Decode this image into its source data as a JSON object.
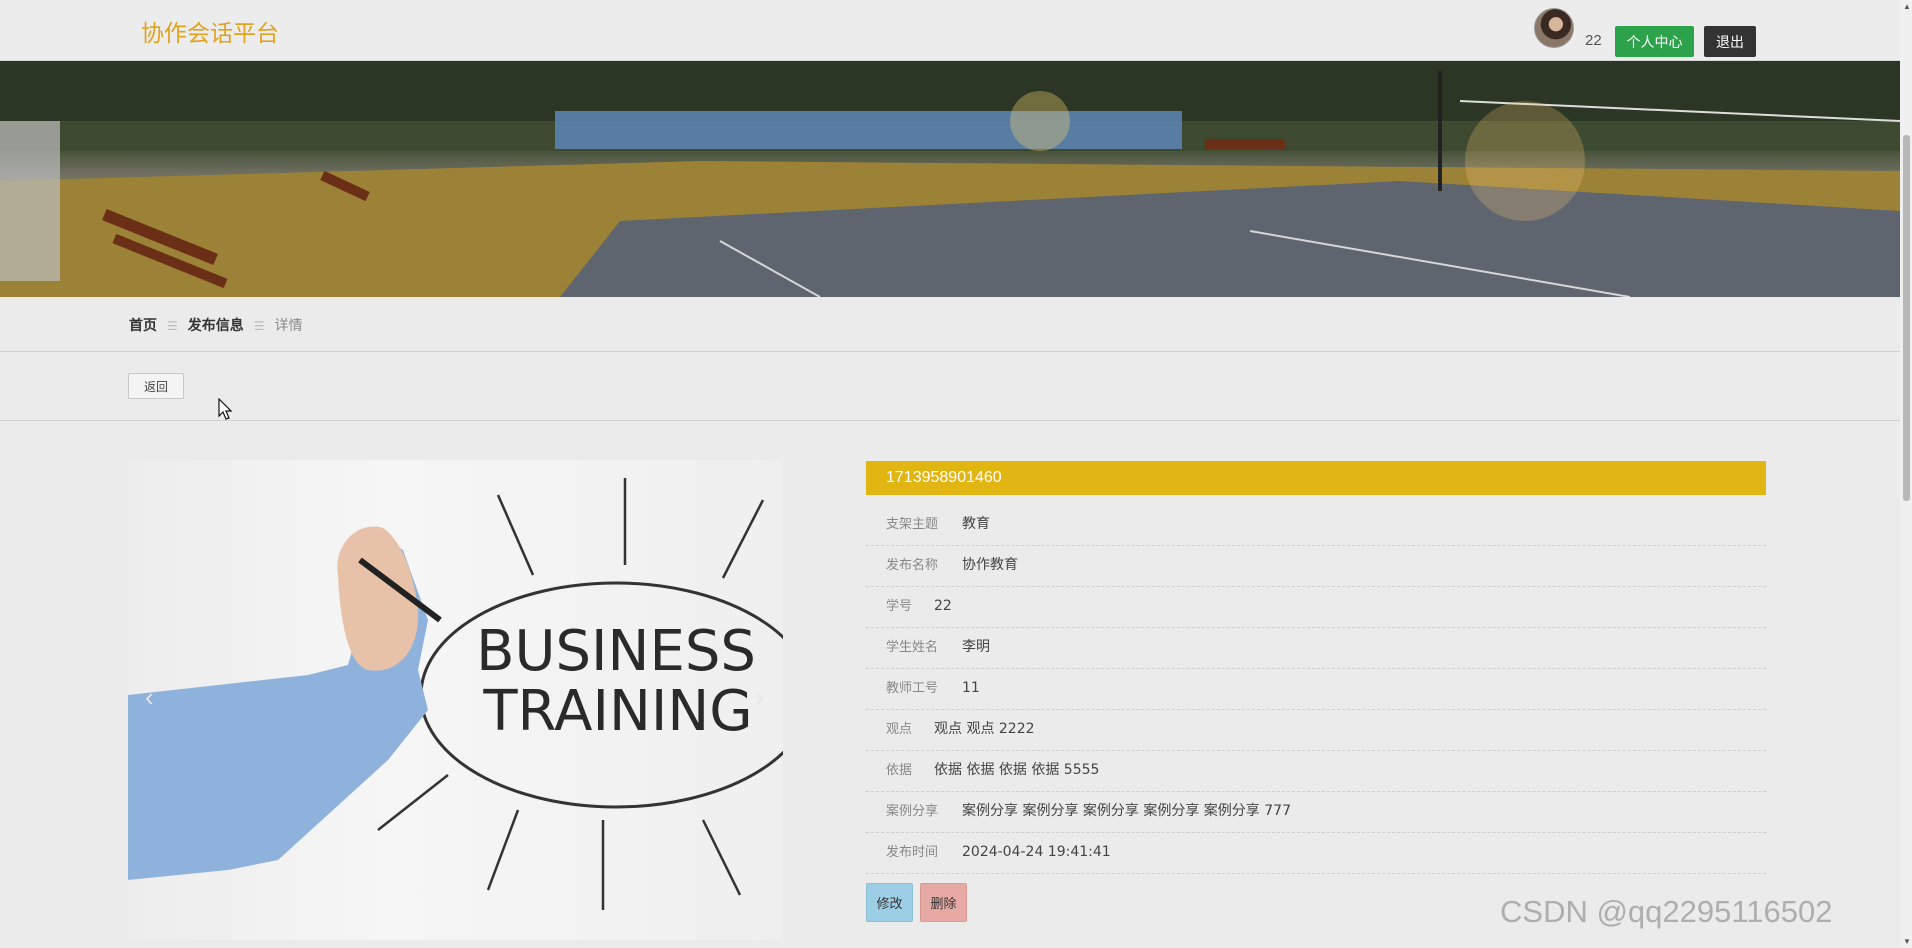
{
  "header": {
    "site_title": "协作会话平台",
    "user_id": "22",
    "personal_center_label": "个人中心",
    "logout_label": "退出"
  },
  "banner": {
    "slide_count": 3,
    "active_slide": 1
  },
  "breadcrumb": {
    "home": "首页",
    "section": "发布信息",
    "current": "详情"
  },
  "back_label": "返回",
  "detail": {
    "id": "1713958901460",
    "image_text_line1": "BUSINESS",
    "image_text_line2": "TRAINING",
    "fields": [
      {
        "label": "支架主题",
        "value": "教育"
      },
      {
        "label": "发布名称",
        "value": "协作教育"
      },
      {
        "label": "学号",
        "value": "22"
      },
      {
        "label": "学生姓名",
        "value": "李明"
      },
      {
        "label": "教师工号",
        "value": "11"
      },
      {
        "label": "观点",
        "value": "观点 观点 2222"
      },
      {
        "label": "依据",
        "value": "依据 依据 依据 依据 5555"
      },
      {
        "label": "案例分享",
        "value": "案例分享 案例分享 案例分享 案例分享 案例分享 777"
      },
      {
        "label": "发布时间",
        "value": "2024-04-24 19:41:41"
      }
    ],
    "edit_label": "修改",
    "delete_label": "删除"
  },
  "watermark": "CSDN @qq2295116502",
  "colors": {
    "accent": "#e1b512",
    "title": "#e0a320",
    "green": "#2ca24b",
    "dark": "#333333",
    "edit": "#9ccfe5",
    "delete": "#e6a9a3"
  }
}
